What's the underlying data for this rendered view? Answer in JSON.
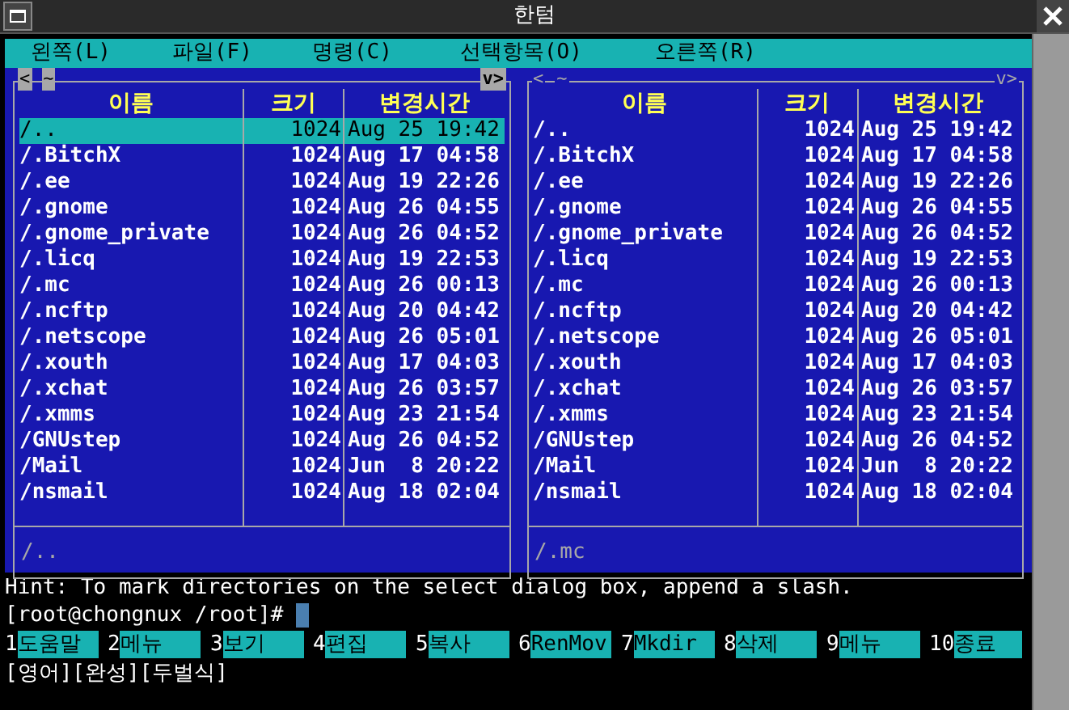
{
  "window": {
    "title": "한텀"
  },
  "menu": [
    "왼쪽(L)",
    "파일(F)",
    "명령(C)",
    "선택항목(O)",
    "오른쪽(R)"
  ],
  "panels": [
    {
      "active": true,
      "corner_left": "<",
      "corner_tilde": "~",
      "corner_right": "v>",
      "columns": [
        "이름",
        "크기",
        "변경시간"
      ],
      "footer": "/..",
      "rows": [
        {
          "name": "/..",
          "size": "1024",
          "time": "Aug 25 19:42",
          "selected": true
        },
        {
          "name": "/.BitchX",
          "size": "1024",
          "time": "Aug 17 04:58",
          "selected": false
        },
        {
          "name": "/.ee",
          "size": "1024",
          "time": "Aug 19 22:26",
          "selected": false
        },
        {
          "name": "/.gnome",
          "size": "1024",
          "time": "Aug 26 04:55",
          "selected": false
        },
        {
          "name": "/.gnome_private",
          "size": "1024",
          "time": "Aug 26 04:52",
          "selected": false
        },
        {
          "name": "/.licq",
          "size": "1024",
          "time": "Aug 19 22:53",
          "selected": false
        },
        {
          "name": "/.mc",
          "size": "1024",
          "time": "Aug 26 00:13",
          "selected": false
        },
        {
          "name": "/.ncftp",
          "size": "1024",
          "time": "Aug 20 04:42",
          "selected": false
        },
        {
          "name": "/.netscope",
          "size": "1024",
          "time": "Aug 26 05:01",
          "selected": false
        },
        {
          "name": "/.xouth",
          "size": "1024",
          "time": "Aug 17 04:03",
          "selected": false
        },
        {
          "name": "/.xchat",
          "size": "1024",
          "time": "Aug 26 03:57",
          "selected": false
        },
        {
          "name": "/.xmms",
          "size": "1024",
          "time": "Aug 23 21:54",
          "selected": false
        },
        {
          "name": "/GNUstep",
          "size": "1024",
          "time": "Aug 26 04:52",
          "selected": false
        },
        {
          "name": "/Mail",
          "size": "1024",
          "time": "Jun  8 20:22",
          "selected": false
        },
        {
          "name": "/nsmail",
          "size": "1024",
          "time": "Aug 18 02:04",
          "selected": false
        }
      ]
    },
    {
      "active": false,
      "corner_left": "<",
      "corner_tilde": "~",
      "corner_right": "v>",
      "columns": [
        "이름",
        "크기",
        "변경시간"
      ],
      "footer": "/.mc",
      "rows": [
        {
          "name": "/..",
          "size": "1024",
          "time": "Aug 25 19:42",
          "selected": false
        },
        {
          "name": "/.BitchX",
          "size": "1024",
          "time": "Aug 17 04:58",
          "selected": false
        },
        {
          "name": "/.ee",
          "size": "1024",
          "time": "Aug 19 22:26",
          "selected": false
        },
        {
          "name": "/.gnome",
          "size": "1024",
          "time": "Aug 26 04:55",
          "selected": false
        },
        {
          "name": "/.gnome_private",
          "size": "1024",
          "time": "Aug 26 04:52",
          "selected": false
        },
        {
          "name": "/.licq",
          "size": "1024",
          "time": "Aug 19 22:53",
          "selected": false
        },
        {
          "name": "/.mc",
          "size": "1024",
          "time": "Aug 26 00:13",
          "selected": false
        },
        {
          "name": "/.ncftp",
          "size": "1024",
          "time": "Aug 20 04:42",
          "selected": false
        },
        {
          "name": "/.netscope",
          "size": "1024",
          "time": "Aug 26 05:01",
          "selected": false
        },
        {
          "name": "/.xouth",
          "size": "1024",
          "time": "Aug 17 04:03",
          "selected": false
        },
        {
          "name": "/.xchat",
          "size": "1024",
          "time": "Aug 26 03:57",
          "selected": false
        },
        {
          "name": "/.xmms",
          "size": "1024",
          "time": "Aug 23 21:54",
          "selected": false
        },
        {
          "name": "/GNUstep",
          "size": "1024",
          "time": "Aug 26 04:52",
          "selected": false
        },
        {
          "name": "/Mail",
          "size": "1024",
          "time": "Jun  8 20:22",
          "selected": false
        },
        {
          "name": "/nsmail",
          "size": "1024",
          "time": "Aug 18 02:04",
          "selected": false
        }
      ]
    }
  ],
  "hint": "Hint: To mark directories on the select dialog box, append a slash.",
  "prompt": "[root@chongnux /root]#",
  "function_keys": [
    {
      "number": "1",
      "label": "도움말"
    },
    {
      "number": "2",
      "label": "메뉴"
    },
    {
      "number": "3",
      "label": "보기"
    },
    {
      "number": "4",
      "label": "편집"
    },
    {
      "number": "5",
      "label": "복사"
    },
    {
      "number": "6",
      "label": "RenMov"
    },
    {
      "number": "7",
      "label": "Mkdir"
    },
    {
      "number": "8",
      "label": "삭제"
    },
    {
      "number": "9",
      "label": "메뉴"
    },
    {
      "number": "10",
      "label": "종료"
    }
  ],
  "input_status": "[영어][완성][두벌식]"
}
